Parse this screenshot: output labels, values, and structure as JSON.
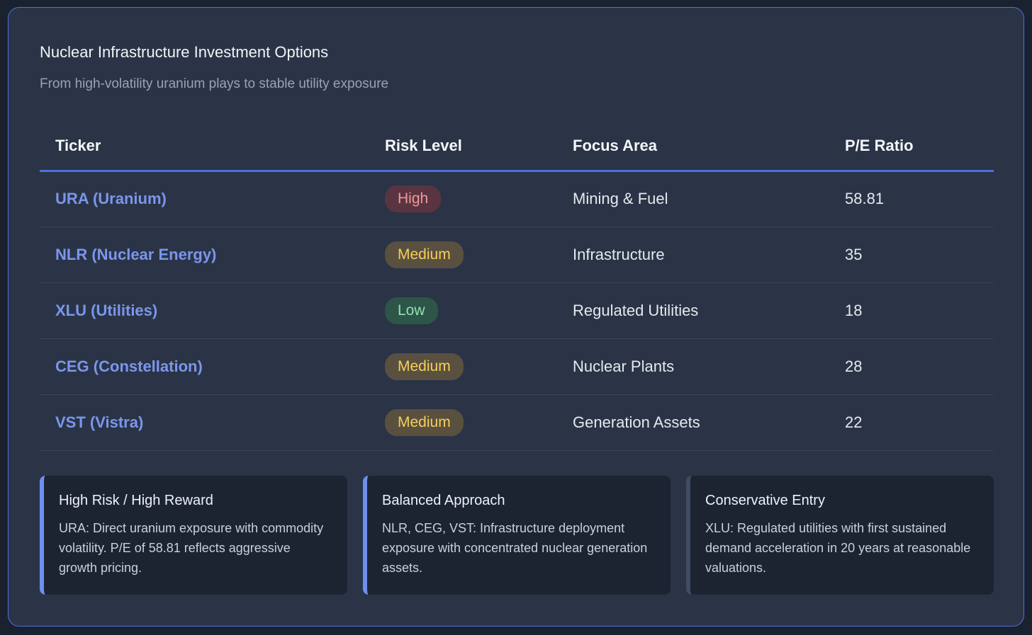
{
  "header": {
    "title": "Nuclear Infrastructure Investment Options",
    "subtitle": "From high-volatility uranium plays to stable utility exposure"
  },
  "table": {
    "columns": [
      "Ticker",
      "Risk Level",
      "Focus Area",
      "P/E Ratio"
    ],
    "rows": [
      {
        "ticker": "URA (Uranium)",
        "risk": "High",
        "risk_level": "high",
        "focus": "Mining & Fuel",
        "pe": "58.81"
      },
      {
        "ticker": "NLR (Nuclear Energy)",
        "risk": "Medium",
        "risk_level": "medium",
        "focus": "Infrastructure",
        "pe": "35"
      },
      {
        "ticker": "XLU (Utilities)",
        "risk": "Low",
        "risk_level": "low",
        "focus": "Regulated Utilities",
        "pe": "18"
      },
      {
        "ticker": "CEG (Constellation)",
        "risk": "Medium",
        "risk_level": "medium",
        "focus": "Nuclear Plants",
        "pe": "28"
      },
      {
        "ticker": "VST (Vistra)",
        "risk": "Medium",
        "risk_level": "medium",
        "focus": "Generation Assets",
        "pe": "22"
      }
    ]
  },
  "notes": [
    {
      "title": "High Risk / High Reward",
      "body": "URA: Direct uranium exposure with commodity volatility. P/E of 58.81 reflects aggressive growth pricing."
    },
    {
      "title": "Balanced Approach",
      "body": "NLR, CEG, VST: Infrastructure deployment exposure with concentrated nuclear generation assets."
    },
    {
      "title": "Conservative Entry",
      "body": "XLU: Regulated utilities with first sustained demand acceleration in 20 years at reasonable valuations."
    }
  ],
  "colors": {
    "accent": "#4f6fe0",
    "ticker_link": "#7b96ec",
    "risk_high": "#f09a9a",
    "risk_medium": "#f5cf5a",
    "risk_low": "#8ee2b2"
  }
}
